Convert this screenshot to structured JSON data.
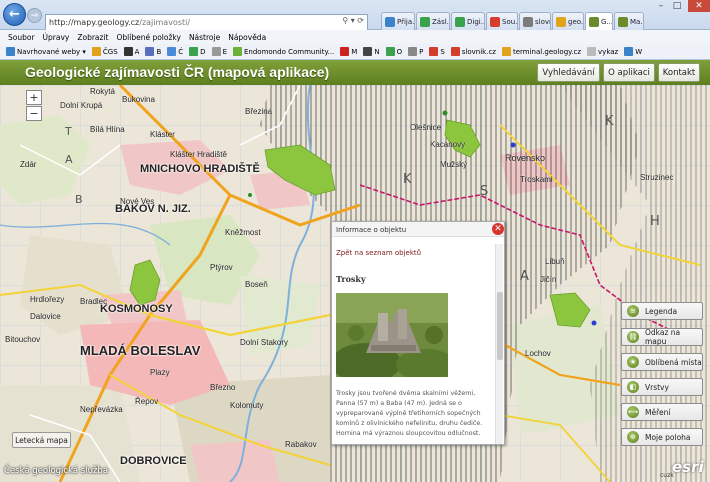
{
  "browser": {
    "address": {
      "host": "http://mapy.geology.cz",
      "path": "/zajimavosti/"
    },
    "tabs": [
      "Přija...",
      "Zásl...",
      "Digi...",
      "Sou...",
      "slovník...",
      "geo...",
      "G...",
      "Ma..."
    ],
    "menu": [
      "Soubor",
      "Úpravy",
      "Zobrazit",
      "Oblíbené položky",
      "Nástroje",
      "Nápověda"
    ],
    "favorites": [
      "Navrhované weby ▾",
      "ČGS",
      "A",
      "B",
      "Ć",
      "D",
      "E",
      "Endomondo Community...",
      "M",
      "N",
      "O",
      "P",
      "S",
      "slovnik.cz",
      "terminal.geology.cz",
      "vykaz",
      "W"
    ]
  },
  "header": {
    "title": "Geologické zajímavosti ČR (mapová aplikace)",
    "buttons": [
      "Vyhledávání",
      "O aplikaci",
      "Kontakt"
    ]
  },
  "map": {
    "zoom_in": "+",
    "zoom_out": "−",
    "basemap_button": "Letecká mapa",
    "attribution": "Česká geologická služba",
    "provider": "esri",
    "provider_small": "cuzk",
    "places": [
      "Rokytá",
      "Bukovina",
      "Dolní Krupá",
      "Březina",
      "Bílá Hlína",
      "Kláster",
      "Mnichovo Hradiště",
      "Bakov n. Jiz.",
      "Kněžmost",
      "Kosmonosy",
      "Mladá Boleslav",
      "Dobrovice",
      "Olešnice",
      "Rovensko",
      "Kacanovy",
      "Troskami",
      "Libuň",
      "Hrdlořezy",
      "Bradlec",
      "Nepřevázka",
      "Plazy",
      "Řepov",
      "Březno",
      "Rabakov",
      "Bitouchov",
      "Ptýrov",
      "Struzinec",
      "Lochov",
      "Jičín",
      "Kolomuty",
      "Dalovice",
      "Dolní Stakory",
      "Nové Ves",
      "Klášter Hradiště",
      "Zdár",
      "Boseň",
      "Mužský"
    ]
  },
  "panel": {
    "header": "Informace o objektu",
    "back_link": "Zpět na seznam objektů",
    "title": "Trosky",
    "description": "Trosky jsou tvořené dvěma skalními věžemi, Panna (57 m) a Baba (47 m). Jedná se o vypreparované výplně třetihorních sopečných komínů z olivínického nefelinitu, druhu čediče. Hornina má výraznou sloupcovitou odlučnost."
  },
  "tools": [
    "Legenda",
    "Odkaz na mapu",
    "Oblíbená místa",
    "Vrstvy",
    "Měření",
    "Moje poloha"
  ],
  "colors": {
    "header_green": "#6b8c2b",
    "polygon_green": "#8cc63f",
    "road_orange": "#f0a31c",
    "road_yellow": "#f2d338",
    "urban_pink": "#f1c6c6",
    "border_magenta": "#c8186a"
  }
}
